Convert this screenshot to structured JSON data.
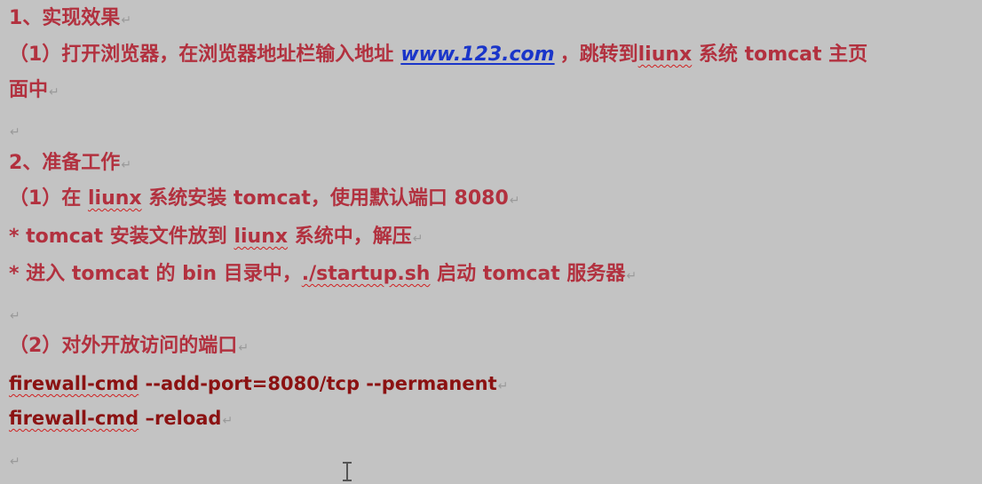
{
  "lines": {
    "l1": {
      "text": "1、实现效果"
    },
    "l2": {
      "prefix": "（1）打开浏览器，在浏览器地址栏输入地址",
      "link": "www.123.com",
      "mid": "，跳转到",
      "word": "liunx",
      "suffix": "系统 tomcat 主页"
    },
    "l3": {
      "text": "面中"
    },
    "l5": {
      "text": "2、准备工作"
    },
    "l6": {
      "prefix": "（1）在",
      "word": "liunx",
      "suffix": "系统安装 tomcat，使用默认端口 8080"
    },
    "l7": {
      "prefix": "* tomcat 安装文件放到",
      "word": "liunx",
      "suffix": "系统中，解压"
    },
    "l8": {
      "prefix": "*  进入 tomcat 的 bin 目录中，",
      "word": "./startup.sh",
      "suffix": "启动 tomcat 服务器"
    },
    "l10": {
      "text": "（2）对外开放访问的端口"
    },
    "l11": {
      "word": "firewall-cmd",
      "suffix": " --add-port=8080/tcp --permanent"
    },
    "l12": {
      "word": "firewall-cmd",
      "suffix": " –reload"
    }
  },
  "paragraph_mark": "↵"
}
